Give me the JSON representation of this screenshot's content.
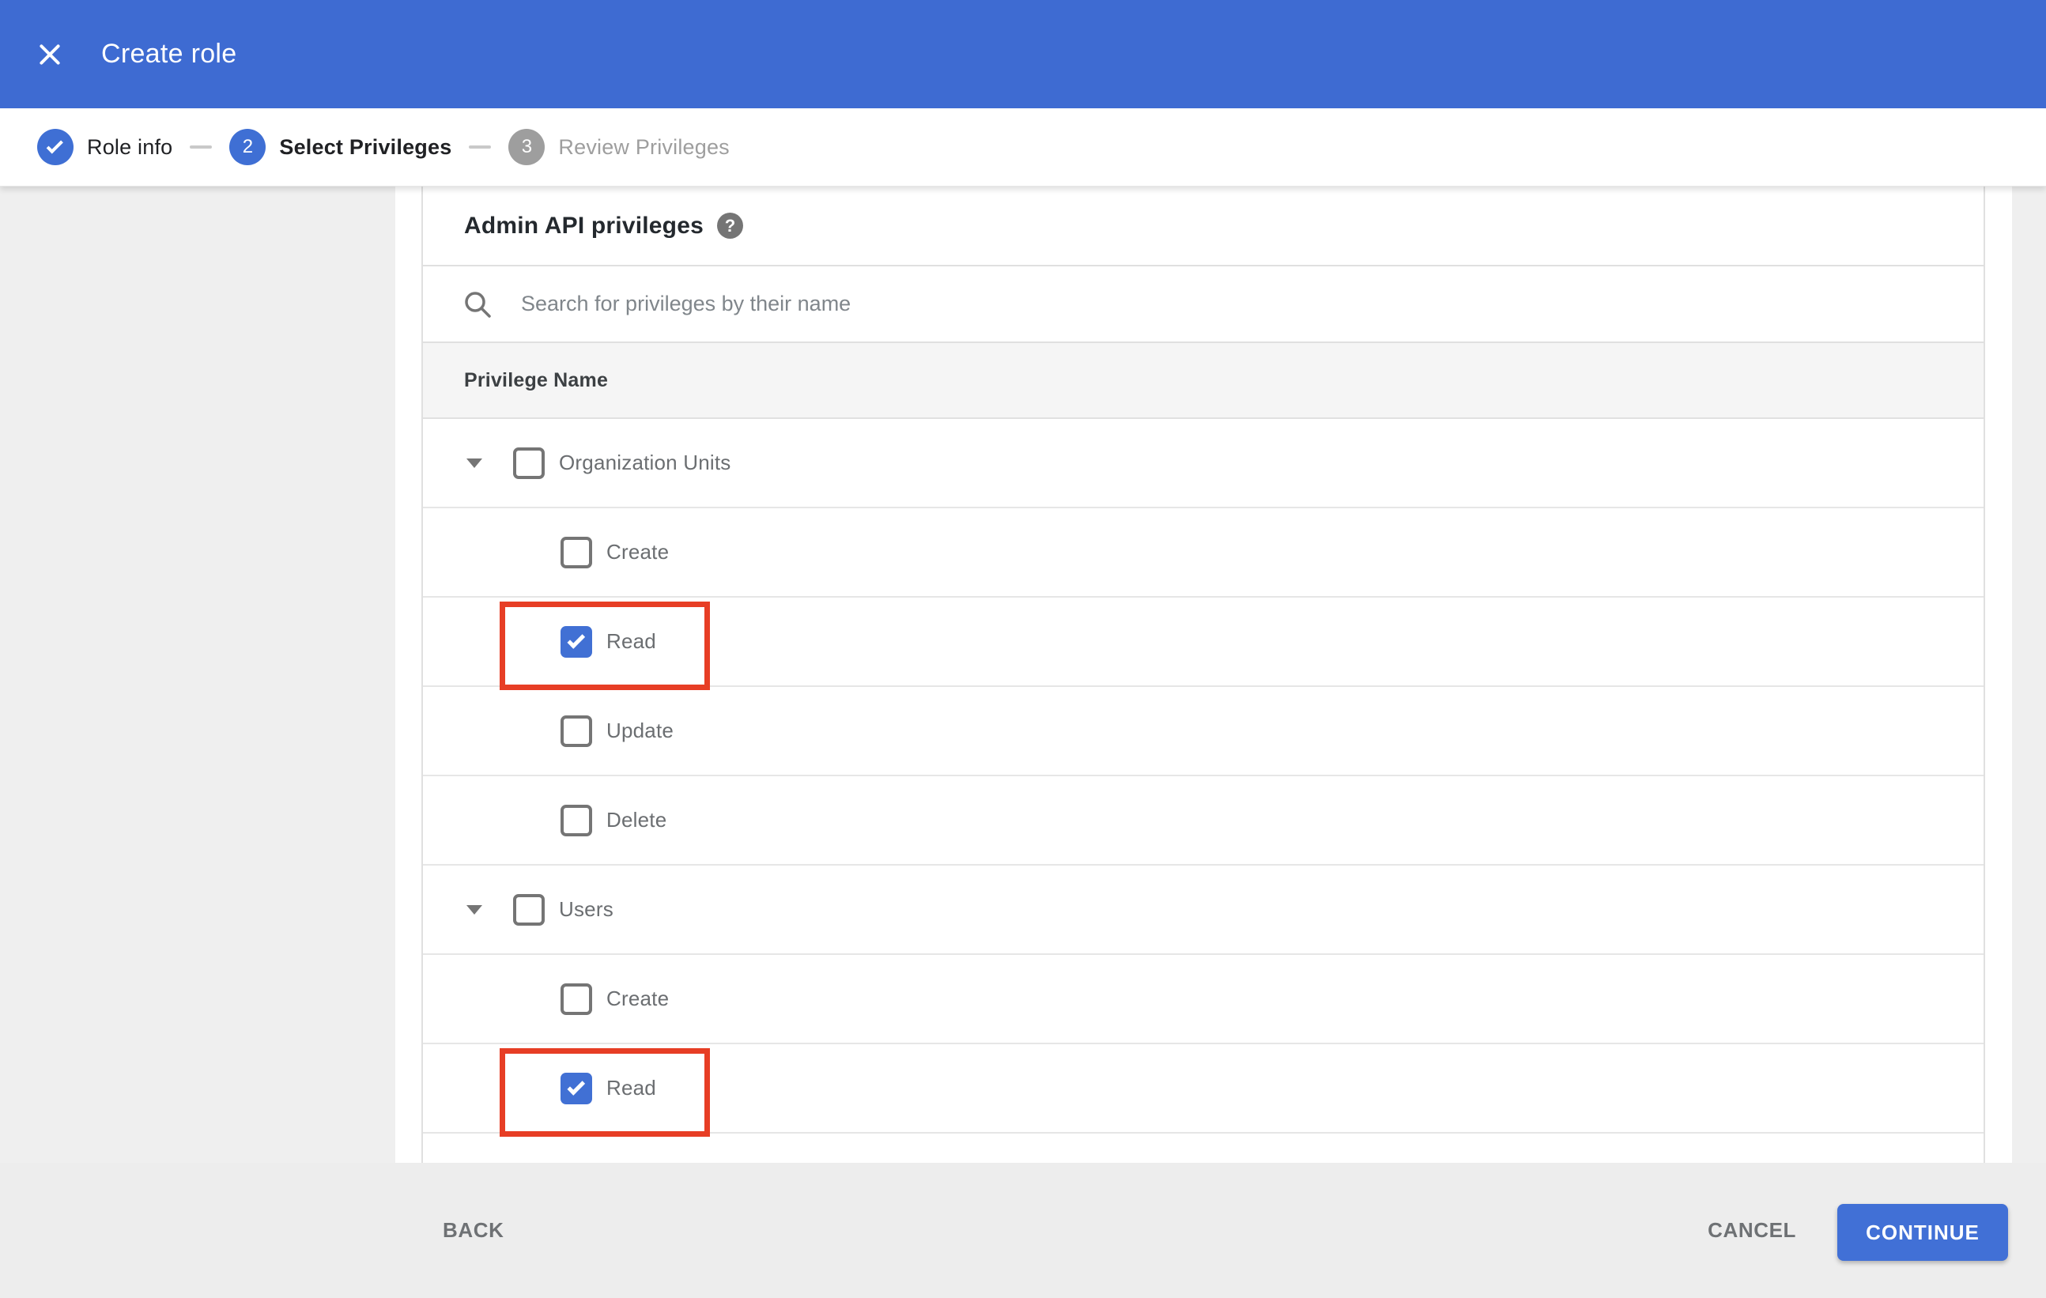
{
  "header": {
    "title": "Create role"
  },
  "stepper": {
    "steps": [
      {
        "number": "1",
        "label": "Role info",
        "state": "completed"
      },
      {
        "number": "2",
        "label": "Select Privileges",
        "state": "active"
      },
      {
        "number": "3",
        "label": "Review Privileges",
        "state": "upcoming"
      }
    ]
  },
  "content": {
    "section_title": "Admin API privileges",
    "help_icon_glyph": "?",
    "search": {
      "placeholder": "Search for privileges by their name",
      "value": ""
    },
    "table": {
      "column_header": "Privilege Name",
      "rows": [
        {
          "type": "parent",
          "label": "Organization Units",
          "expanded": true,
          "checked": false,
          "annotated": false
        },
        {
          "type": "child",
          "label": "Create",
          "checked": false,
          "annotated": false
        },
        {
          "type": "child",
          "label": "Read",
          "checked": true,
          "annotated": true
        },
        {
          "type": "child",
          "label": "Update",
          "checked": false,
          "annotated": false
        },
        {
          "type": "child",
          "label": "Delete",
          "checked": false,
          "annotated": false
        },
        {
          "type": "parent",
          "label": "Users",
          "expanded": true,
          "checked": false,
          "annotated": false
        },
        {
          "type": "child",
          "label": "Create",
          "checked": false,
          "annotated": false
        },
        {
          "type": "child",
          "label": "Read",
          "checked": true,
          "annotated": true
        }
      ]
    }
  },
  "footer": {
    "back_label": "BACK",
    "cancel_label": "CANCEL",
    "continue_label": "CONTINUE"
  },
  "colors": {
    "header_blue": "#3e6bd2",
    "accent_blue": "#4170d5",
    "annotation_red": "#e73e25",
    "step_inactive_gray": "#9e9e9e",
    "header_row_bg": "#f5f5f5",
    "footer_bg": "#ededed"
  }
}
